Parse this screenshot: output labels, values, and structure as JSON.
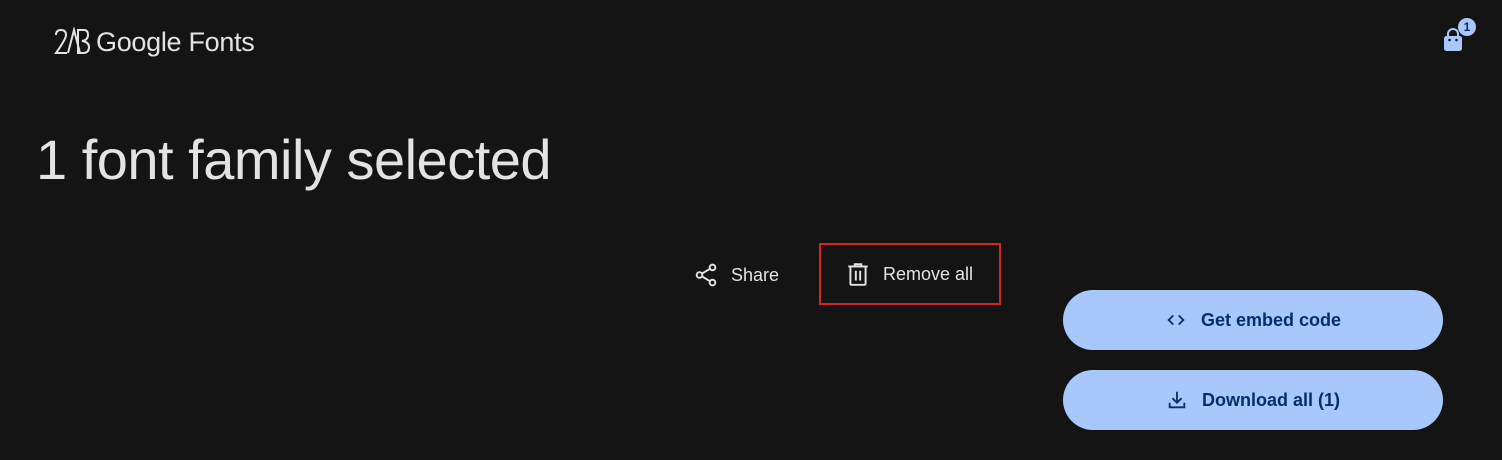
{
  "header": {
    "logo_text": "Google Fonts",
    "logo_icon": "google-fonts-logo-icon",
    "cart": {
      "icon": "shopping-bag-icon",
      "badge_count": "1"
    }
  },
  "main": {
    "title": "1 font family selected",
    "actions": {
      "share_label": "Share",
      "share_icon": "share-icon",
      "remove_all_label": "Remove all",
      "remove_all_icon": "trash-icon"
    },
    "buttons": {
      "embed_label": "Get embed code",
      "embed_icon": "code-icon",
      "download_label": "Download all (1)",
      "download_icon": "download-icon"
    }
  },
  "colors": {
    "background": "#141414",
    "text": "#e3e3e3",
    "primary_button_bg": "#a8c7fa",
    "primary_button_text": "#062e6f",
    "highlight_border": "#d42424"
  }
}
